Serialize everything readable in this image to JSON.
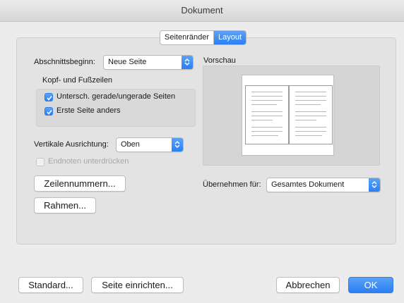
{
  "window": {
    "title": "Dokument"
  },
  "tabs": [
    {
      "label": "Seitenränder",
      "active": false
    },
    {
      "label": "Layout",
      "active": true
    }
  ],
  "section_start": {
    "label": "Abschnittsbeginn:",
    "value": "Neue Seite"
  },
  "header_footer": {
    "title": "Kopf- und Fußzeilen",
    "odd_even": {
      "label": "Untersch. gerade/ungerade Seiten",
      "checked": true
    },
    "first_page": {
      "label": "Erste Seite anders",
      "checked": true
    }
  },
  "vertical_alignment": {
    "label": "Vertikale Ausrichtung:",
    "value": "Oben"
  },
  "suppress_endnotes": {
    "label": "Endnoten unterdrücken",
    "checked": false,
    "enabled": false
  },
  "buttons": {
    "line_numbers": "Zeilennummern...",
    "borders": "Rahmen...",
    "default": "Standard...",
    "page_setup": "Seite einrichten...",
    "cancel": "Abbrechen",
    "ok": "OK"
  },
  "preview": {
    "label": "Vorschau"
  },
  "apply_to": {
    "label": "Übernehmen für:",
    "value": "Gesamtes Dokument"
  },
  "colors": {
    "accent": "#2b7ff2",
    "panel": "#e3e3e3",
    "window": "#ececec"
  }
}
